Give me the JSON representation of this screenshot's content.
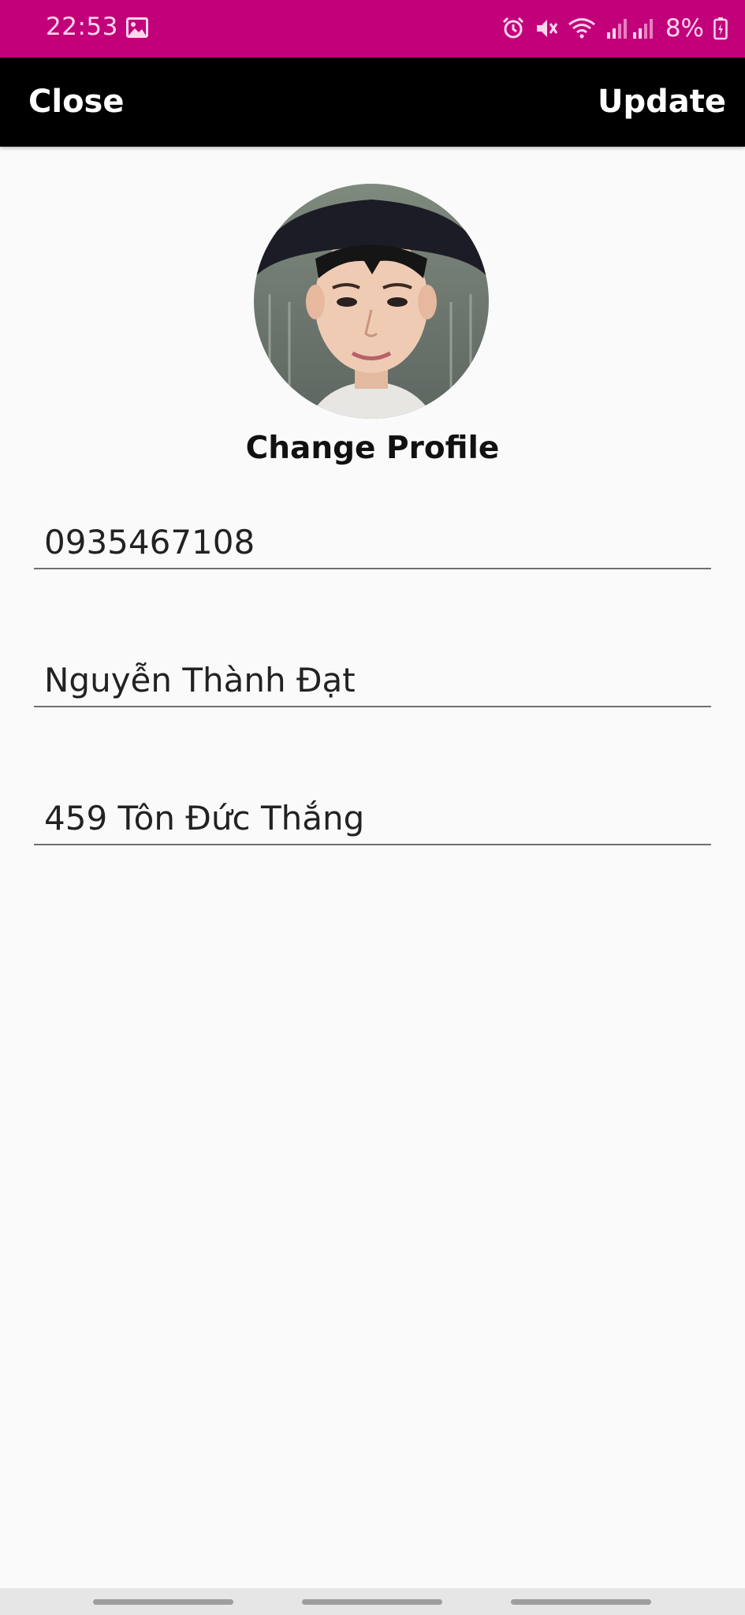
{
  "status_bar": {
    "time": "22:53",
    "battery": "8%",
    "background_color": "#c2007a",
    "icons": [
      "gallery-icon",
      "alarm-icon",
      "mute-icon",
      "wifi-icon",
      "signal-icon",
      "battery-icon"
    ]
  },
  "app_bar": {
    "close_label": "Close",
    "update_label": "Update",
    "background_color": "#000000"
  },
  "profile": {
    "change_profile_label": "Change Profile"
  },
  "form": {
    "phone": "0935467108",
    "name": "Nguyễn Thành Đạt",
    "address": "459 Tôn Đức Thắng"
  }
}
